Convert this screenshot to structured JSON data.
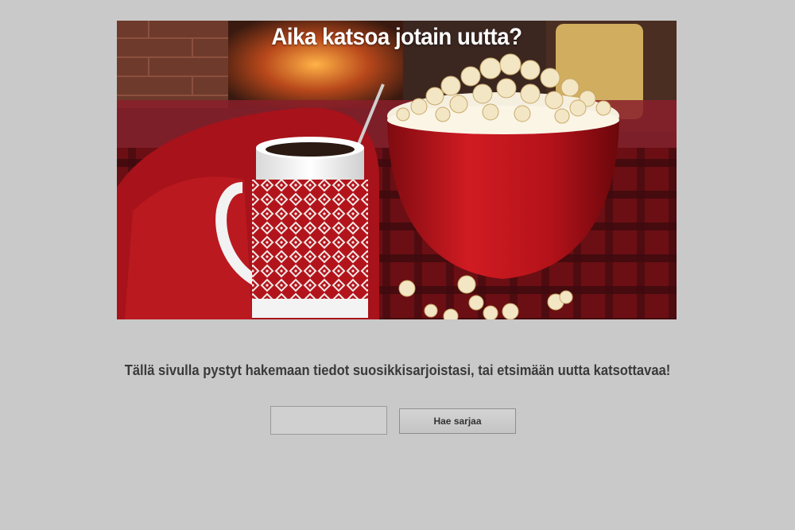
{
  "hero": {
    "title": "Aika katsoa jotain uutta?",
    "image_description_icon": "coffee-mug-popcorn-bowl-image"
  },
  "intro": {
    "text": "Tällä sivulla pystyt hakemaan tiedot suosikkisarjoistasi, tai etsimään uutta katsottavaa!"
  },
  "search": {
    "value": "",
    "placeholder": "",
    "button_label": "Hae sarjaa"
  },
  "colors": {
    "page_background": "#c9c9c9",
    "bowl_red": "#c3161c",
    "blanket_red": "#b0141a",
    "popcorn": "#f3e6c4"
  }
}
